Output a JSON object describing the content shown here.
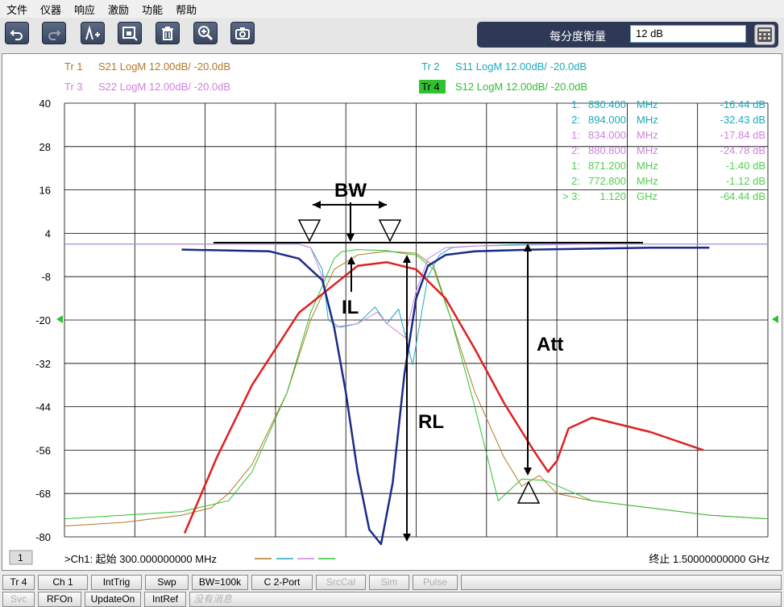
{
  "menu": [
    "文件",
    "仪器",
    "响应",
    "激励",
    "功能",
    "帮助"
  ],
  "toolbar": {
    "buttons": [
      "undo-icon",
      "redo-icon",
      "add-marker-icon",
      "screen-capture-icon",
      "trash-icon",
      "zoom-icon",
      "camera-icon"
    ],
    "scale_label": "每分度衡量",
    "scale_value": "12 dB"
  },
  "traces": [
    {
      "label": "Tr  1",
      "desc": "S21 LogM 12.00dB/  -20.0dB",
      "color": "#b07828"
    },
    {
      "label": "Tr  2",
      "desc": "S11 LogM 12.00dB/  -20.0dB",
      "color": "#20a8b8"
    },
    {
      "label": "Tr  3",
      "desc": "S22 LogM 12.00dB/  -20.0dB",
      "color": "#d080e0"
    },
    {
      "label": "Tr  4",
      "desc": "S12 LogM 12.00dB/  -20.0dB",
      "color": "#30c030"
    }
  ],
  "markers": [
    {
      "id": "1:",
      "freq": "830.400",
      "unit": "MHz",
      "val": "-16.44 dB",
      "color": "#20a8b8"
    },
    {
      "id": "2:",
      "freq": "894.000",
      "unit": "MHz",
      "val": "-32.43 dB",
      "color": "#20a8b8"
    },
    {
      "id": "1:",
      "freq": "834.000",
      "unit": "MHz",
      "val": "-17.84 dB",
      "color": "#d080e0"
    },
    {
      "id": "2:",
      "freq": "880.800",
      "unit": "MHz",
      "val": "-24.78 dB",
      "color": "#d080e0"
    },
    {
      "id": "1:",
      "freq": "871.200",
      "unit": "MHz",
      "val": "-1.40 dB",
      "color": "#50d050"
    },
    {
      "id": "2:",
      "freq": "772.800",
      "unit": "MHz",
      "val": "-1.12 dB",
      "color": "#50d050"
    },
    {
      "id": "> 3:",
      "freq": "1.120",
      "unit": "GHz",
      "val": "-64.44 dB",
      "color": "#50d050"
    }
  ],
  "y_ticks": [
    "40",
    "28",
    "16",
    "4",
    "-8",
    "-20",
    "-32",
    "-44",
    "-56",
    "-68",
    "-80"
  ],
  "annotations": {
    "bw": "BW",
    "il": "IL",
    "att": "Att",
    "rl": "RL"
  },
  "footer": {
    "channel_num": "1",
    "start": ">Ch1: 起始  300.000000000 MHz",
    "stop": "终止  1.50000000000 GHz"
  },
  "status_row1": [
    "Tr 4",
    "Ch 1",
    "IntTrig",
    "Swp",
    "BW=100k",
    "C  2-Port",
    "SrcCal",
    "Sim",
    "Pulse"
  ],
  "status_row2": [
    "Svc",
    "RFOn",
    "UpdateOn",
    "IntRef",
    "没有消息"
  ],
  "chart_data": {
    "type": "line",
    "title": "",
    "xlim_mhz": [
      300,
      1500
    ],
    "ylim_db": [
      -80,
      40
    ],
    "y_tick_values": [
      40,
      28,
      16,
      4,
      -8,
      -20,
      -32,
      -44,
      -56,
      -68,
      -80
    ],
    "series": [
      {
        "name": "S21",
        "color": "#b07828",
        "x": [
          300,
          400,
          450,
          500,
          550,
          580,
          620,
          680,
          720,
          760,
          800,
          850,
          900,
          930,
          960,
          1000,
          1050,
          1080,
          1110,
          1140,
          1200,
          1300,
          1400,
          1500
        ],
        "y": [
          -77,
          -76,
          -75,
          -74,
          -72,
          -68,
          -60,
          -40,
          -20,
          -6,
          -2,
          -1,
          -1.5,
          -5,
          -20,
          -40,
          -58,
          -66,
          -63,
          -68,
          -70,
          -72,
          -74,
          -75
        ]
      },
      {
        "name": "S11",
        "color": "#20a8b8",
        "x": [
          300,
          700,
          720,
          740,
          750,
          770,
          800,
          830,
          850,
          870,
          894,
          920,
          940,
          960,
          1000,
          1100,
          1300,
          1500
        ],
        "y": [
          1,
          1,
          0,
          -6,
          -20,
          -22,
          -21,
          -16.4,
          -21,
          -17,
          -32.4,
          -8,
          -2,
          0,
          0.5,
          1,
          1,
          1
        ]
      },
      {
        "name": "S22",
        "color": "#d080e0",
        "x": [
          300,
          700,
          720,
          740,
          760,
          800,
          834,
          850,
          880.8,
          900,
          920,
          950,
          1000,
          1200,
          1500
        ],
        "y": [
          1,
          1,
          0,
          -8,
          -22,
          -21,
          -17.8,
          -21,
          -24.8,
          -12,
          -3,
          0,
          0.5,
          1,
          1
        ]
      },
      {
        "name": "S12",
        "color": "#30c030",
        "x": [
          300,
          400,
          500,
          580,
          620,
          680,
          720,
          760,
          772.8,
          800,
          850,
          871.2,
          900,
          930,
          960,
          1000,
          1040,
          1080,
          1120,
          1200,
          1300,
          1400,
          1500
        ],
        "y": [
          -75,
          -74,
          -73,
          -70,
          -62,
          -40,
          -18,
          -3,
          -1.1,
          -0.5,
          -0.8,
          -1.4,
          -2,
          -6,
          -20,
          -44,
          -70,
          -64,
          -64.4,
          -70,
          -72,
          -74,
          -75
        ]
      },
      {
        "name": "",
        "color": "#e02020",
        "x": [
          505,
          560,
          620,
          700,
          800,
          850,
          900,
          950,
          1000,
          1050,
          1100,
          1125,
          1140,
          1160,
          1200,
          1300,
          1390
        ],
        "y": [
          -79,
          -58,
          -38,
          -18,
          -5,
          -4,
          -6,
          -14,
          -28,
          -43,
          -56,
          -62,
          -59,
          -50,
          -47,
          -51,
          -56
        ]
      },
      {
        "name": "",
        "color": "#1a2a8a",
        "x": [
          500,
          650,
          700,
          740,
          760,
          780,
          800,
          820,
          840,
          860,
          880,
          900,
          920,
          950,
          1000,
          1100,
          1300,
          1400
        ],
        "y": [
          -0.5,
          -1,
          -3,
          -9,
          -22,
          -40,
          -62,
          -78,
          -82,
          -65,
          -35,
          -14,
          -5,
          -2,
          -1,
          -0.5,
          0,
          0
        ]
      }
    ]
  }
}
